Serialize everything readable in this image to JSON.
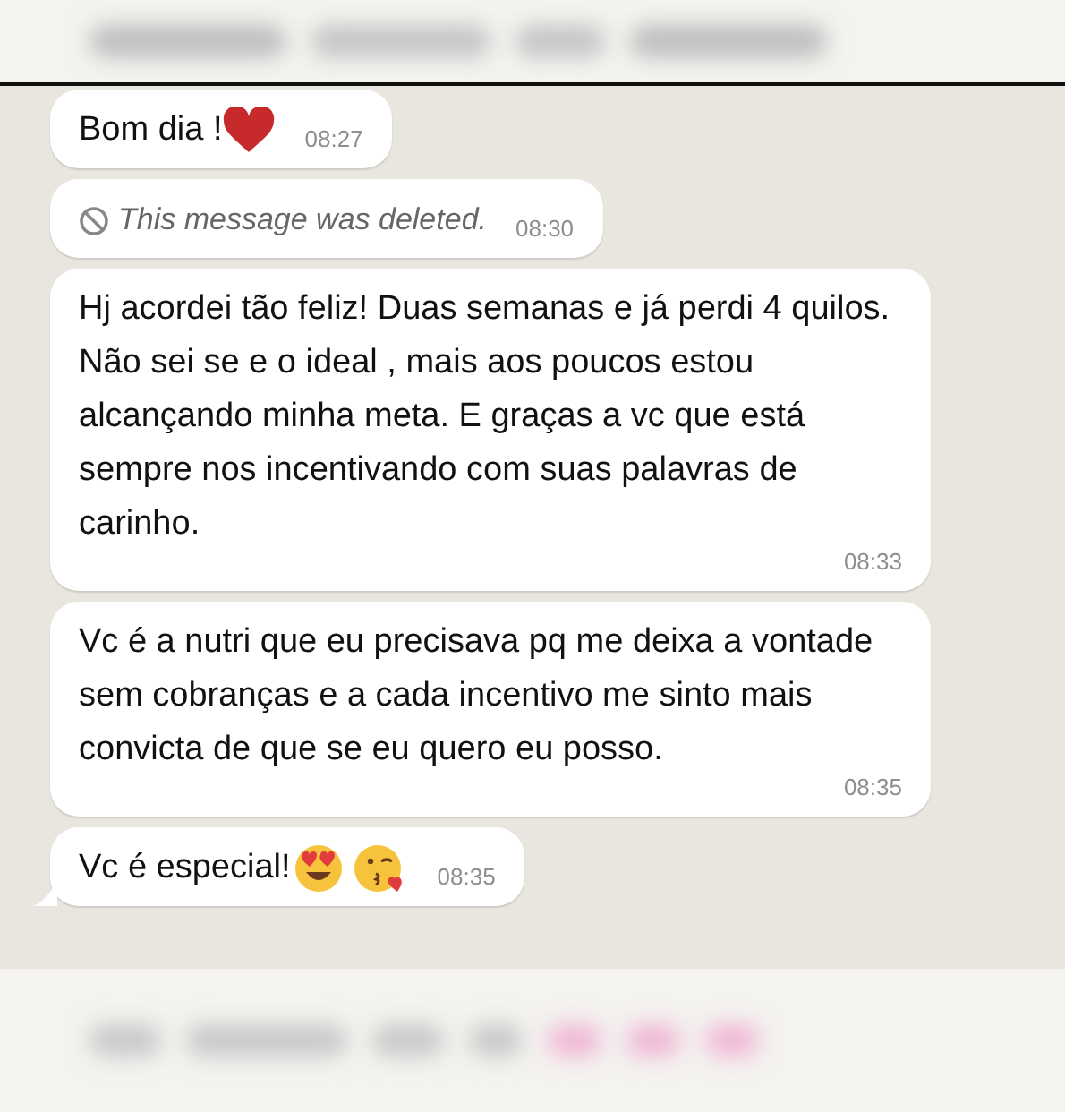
{
  "messages": [
    {
      "kind": "text",
      "text": "Bom dia !",
      "emojis": [
        {
          "kind": "heart"
        }
      ],
      "time": "08:27",
      "tail": false
    },
    {
      "kind": "deleted",
      "text": "This message was deleted.",
      "time": "08:30",
      "tail": false
    },
    {
      "kind": "text",
      "text": "Hj acordei tão feliz! Duas semanas e já perdi 4 quilos. Não sei se e o ideal , mais aos poucos estou alcançando minha meta. E graças a vc que está sempre nos incentivando com suas palavras de carinho.",
      "time": "08:33",
      "tail": false
    },
    {
      "kind": "text",
      "text": "Vc é a nutri que eu precisava pq me deixa a vontade sem cobranças e a cada incentivo me sinto mais convicta de que se eu quero eu posso.",
      "time": "08:35",
      "tail": false
    },
    {
      "kind": "text",
      "text": "Vc é especial!",
      "emojis": [
        {
          "kind": "heart-eyes"
        },
        {
          "kind": "kiss"
        }
      ],
      "time": "08:35",
      "tail": true
    }
  ]
}
